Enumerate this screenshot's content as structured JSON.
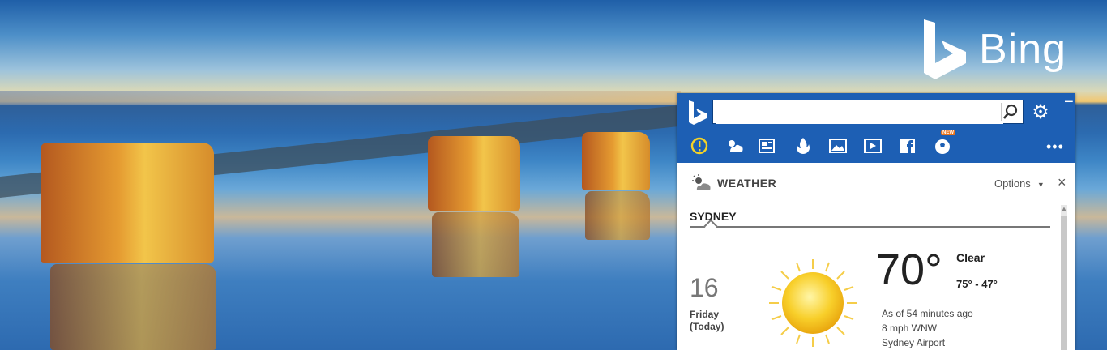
{
  "brand": {
    "name": "Bing"
  },
  "toolbar": {
    "search_value": "",
    "icons": [
      "alert-icon",
      "weather-icon",
      "news-icon",
      "trending-icon",
      "images-icon",
      "video-icon",
      "facebook-icon",
      "sports-icon"
    ],
    "sports_badge": "NEW",
    "more_label": "•••"
  },
  "weather": {
    "title": "WEATHER",
    "options_label": "Options",
    "close_label": "×",
    "city_tab": "SYDNEY",
    "date_number": "16",
    "day_name": "Friday",
    "day_note": "(Today)",
    "temperature": "70°",
    "condition": "Clear",
    "range": "75° - 47°",
    "updated": "As of 54 minutes ago",
    "wind": "8 mph WNW",
    "station": "Sydney Airport"
  },
  "colors": {
    "toolbar_blue": "#1d5fb4",
    "sun": "#f6c21a"
  }
}
